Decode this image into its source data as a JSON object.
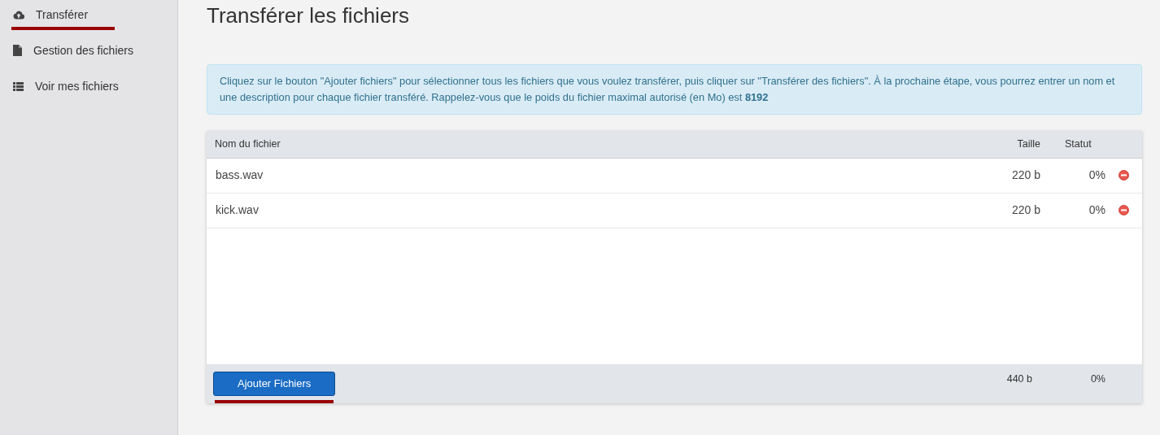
{
  "sidebar": {
    "items": [
      {
        "label": "Transférer",
        "kind": "upload",
        "selected": true
      },
      {
        "label": "Gestion des fichiers",
        "kind": "file",
        "selected": false
      },
      {
        "label": "Voir mes fichiers",
        "kind": "list",
        "selected": false
      }
    ]
  },
  "page": {
    "title": "Transférer les fichiers"
  },
  "alert": {
    "text": "Cliquez sur le bouton \"Ajouter fichiers\" pour sélectionner tous les fichiers que vous voulez transférer, puis cliquer sur \"Transférer des fichiers\". À la prochaine étape, vous pourrez entrer un nom et une description pour chaque fichier transféré. Rappelez-vous que le poids du fichier maximal autorisé (en Mo) est **8192**"
  },
  "table": {
    "columns": [
      "Nom du fichier",
      "Taille",
      "Statut"
    ],
    "rows": [
      {
        "name": "bass.wav",
        "size": "220 b",
        "status": "0%"
      },
      {
        "name": "kick.wav",
        "size": "220 b",
        "status": "0%"
      }
    ],
    "footer": {
      "button": {
        "label": "Ajouter Fichiers",
        "selected": true
      },
      "total_size": "440 b",
      "total_status": "0%"
    }
  }
}
